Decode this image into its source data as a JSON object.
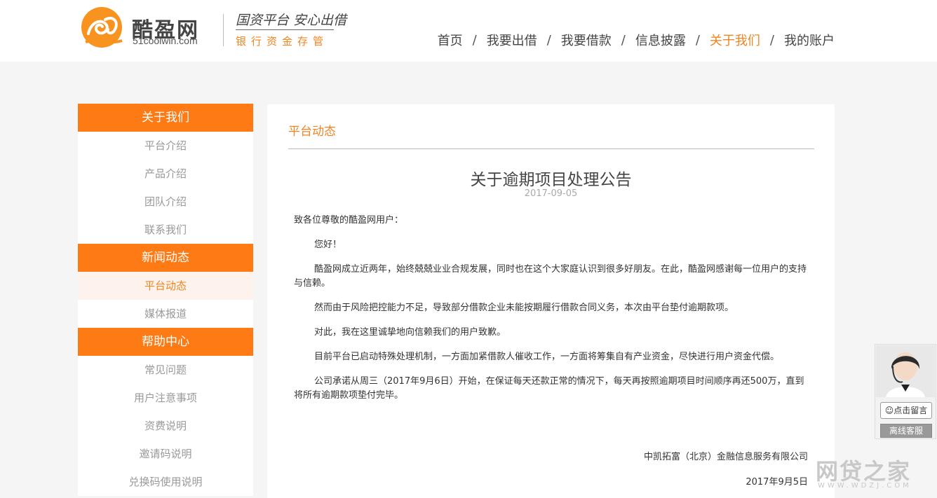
{
  "header": {
    "brand_cn": "酷盈网",
    "brand_en": "51coolwin.com",
    "slogan_top": "国资平台 安心出借",
    "slogan_bottom": "银行资金存管",
    "nav": [
      {
        "label": "首页",
        "active": false
      },
      {
        "label": "我要出借",
        "active": false
      },
      {
        "label": "我要借款",
        "active": false
      },
      {
        "label": "信息披露",
        "active": false
      },
      {
        "label": "关于我们",
        "active": true
      },
      {
        "label": "我的账户",
        "active": false
      }
    ],
    "separator": "/"
  },
  "sidebar": {
    "sections": [
      {
        "title": "关于我们",
        "items": [
          {
            "label": "平台介绍"
          },
          {
            "label": "产品介绍"
          },
          {
            "label": "团队介绍"
          },
          {
            "label": "联系我们"
          }
        ]
      },
      {
        "title": "新闻动态",
        "items": [
          {
            "label": "平台动态",
            "active": true
          },
          {
            "label": "媒体报道"
          }
        ]
      },
      {
        "title": "帮助中心",
        "items": [
          {
            "label": "常见问题"
          },
          {
            "label": "用户注意事项"
          },
          {
            "label": "资费说明"
          },
          {
            "label": "邀请码说明"
          },
          {
            "label": "兑换码使用说明"
          }
        ]
      }
    ]
  },
  "main": {
    "section_title": "平台动态",
    "article": {
      "title": "关于逾期项目处理公告",
      "date": "2017-09-05",
      "greeting": "致各位尊敬的酷盈网用户：",
      "paragraphs": [
        "您好！",
        "酷盈网成立近两年，始终兢兢业业合规发展，同时也在这个大家庭认识到很多好朋友。在此，酷盈网感谢每一位用户的支持与信赖。",
        "然而由于风险把控能力不足，导致部分借款企业未能按期履行借款合同义务，本次由平台垫付逾期款项。",
        "对此，我在这里诚挚地向信赖我们的用户致歉。",
        "目前平台已启动特殊处理机制，一方面加紧借款人催收工作，一方面将筹集自有产业资金，尽快进行用户资金代偿。",
        "公司承诺从周三（2017年9月6日）开始，在保证每天还款正常的情况下，每天再按照逾期项目时间顺序再还500万，直到将所有逾期款项垫付完毕。"
      ],
      "signature": "中凯拓富（北京）金融信息服务有限公司",
      "sign_date": "2017年9月5日"
    }
  },
  "customer_service": {
    "message_button": "点击留言",
    "offline_label": "离线客服"
  },
  "watermark": {
    "text": "网贷之家",
    "url": "WWW.WDZJ.COM"
  },
  "colors": {
    "accent": "#fe7a15",
    "accent_text": "#f08522"
  }
}
